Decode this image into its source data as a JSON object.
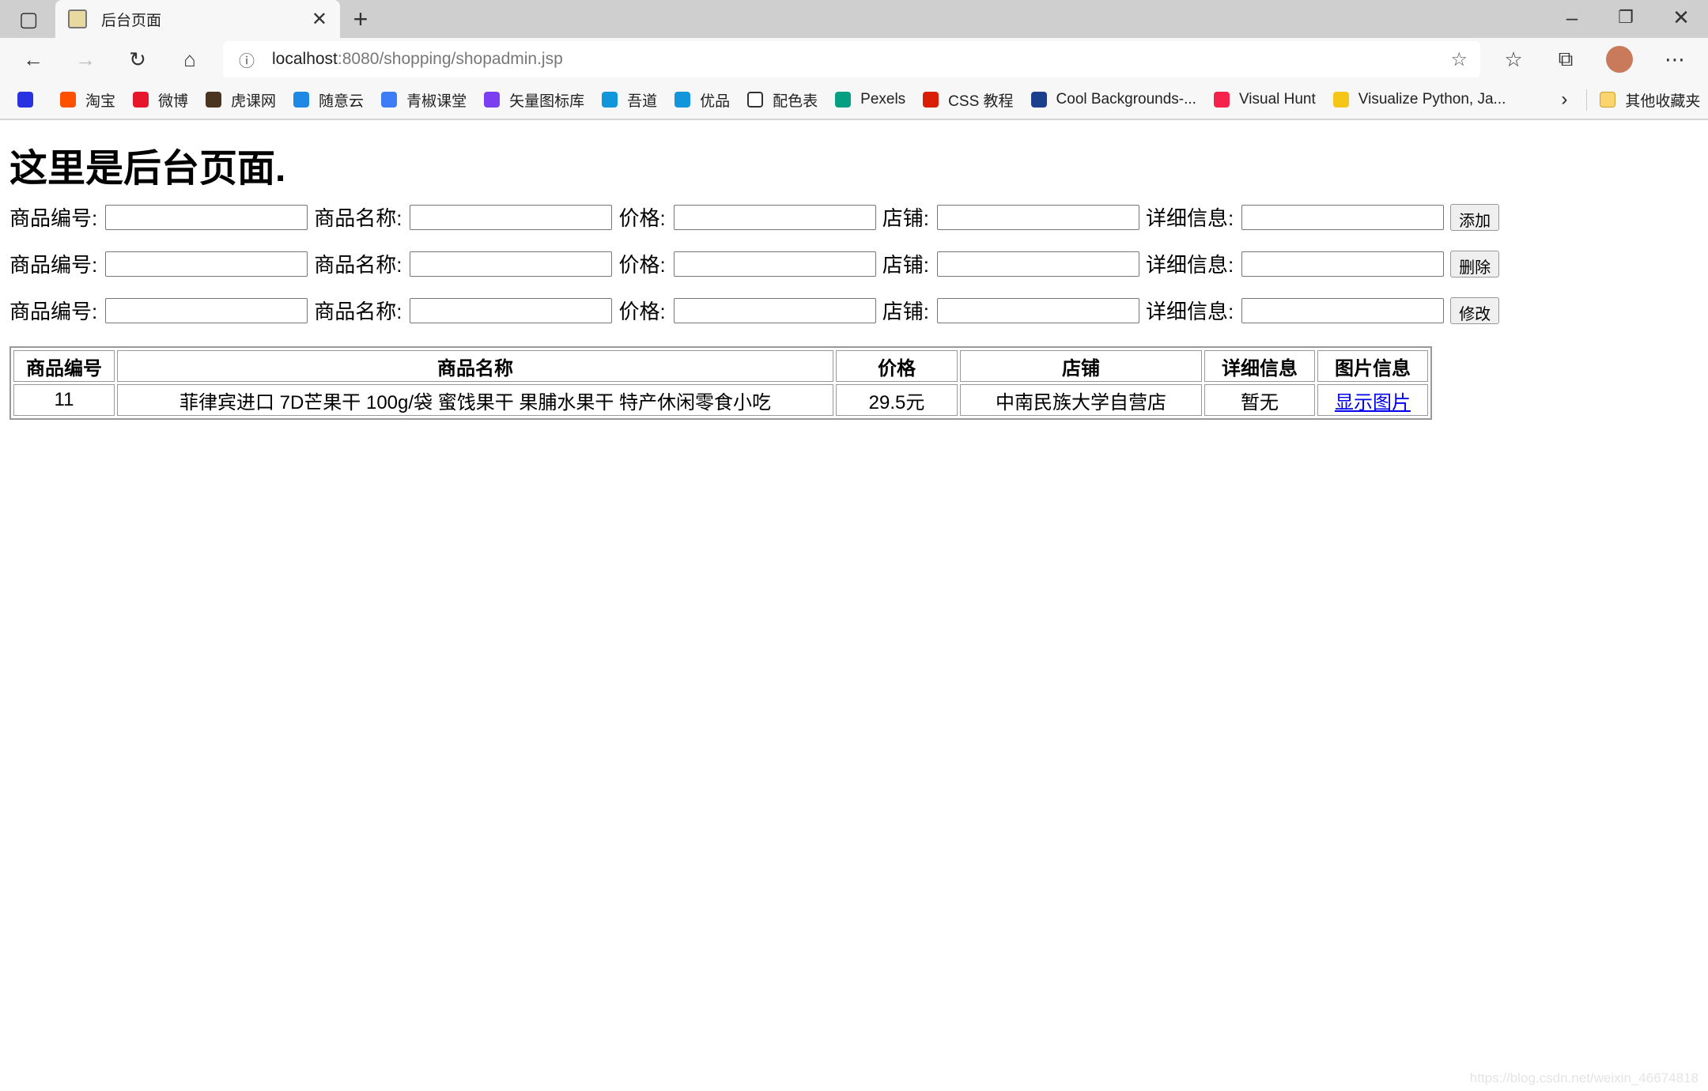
{
  "browser": {
    "tab_title": "后台页面",
    "url_host": "localhost",
    "url_path": ":8080/shopping/shopadmin.jsp",
    "bookmarks": [
      {
        "label": "",
        "color": "#2932e1"
      },
      {
        "label": "淘宝",
        "color": "#ff5000"
      },
      {
        "label": "微博",
        "color": "#e6162d"
      },
      {
        "label": "虎课网",
        "color": "#4a3520"
      },
      {
        "label": "随意云",
        "color": "#1e88e5"
      },
      {
        "label": "青椒课堂",
        "color": "#3d7bf7"
      },
      {
        "label": "矢量图标库",
        "color": "#7b3ff2"
      },
      {
        "label": "吾道",
        "color": "#1296db"
      },
      {
        "label": "优品",
        "color": "#1296db"
      },
      {
        "label": "配色表",
        "color": "#ffffff"
      },
      {
        "label": "Pexels",
        "color": "#05a081"
      },
      {
        "label": "CSS 教程",
        "color": "#d81e06"
      },
      {
        "label": "Cool Backgrounds-...",
        "color": "#1a3f8c"
      },
      {
        "label": "Visual Hunt",
        "color": "#f5224b"
      },
      {
        "label": "Visualize Python, Ja...",
        "color": "#f5c518"
      }
    ],
    "other_bookmarks": "其他收藏夹"
  },
  "page": {
    "heading": "这里是后台页面.",
    "forms": [
      {
        "button": "添加"
      },
      {
        "button": "删除"
      },
      {
        "button": "修改"
      }
    ],
    "labels": [
      "商品编号:",
      "商品名称:",
      "价格:",
      "店铺:",
      "详细信息:"
    ],
    "table": {
      "headers": [
        "商品编号",
        "商品名称",
        "价格",
        "店铺",
        "详细信息",
        "图片信息"
      ],
      "rows": [
        [
          "11",
          "菲律宾进口 7D芒果干 100g/袋 蜜饯果干 果脯水果干 特产休闲零食小吃",
          "29.5元",
          "中南民族大学自营店",
          "暂无",
          "显示图片"
        ]
      ]
    }
  },
  "watermark": "https://blog.csdn.net/weixin_46674818"
}
